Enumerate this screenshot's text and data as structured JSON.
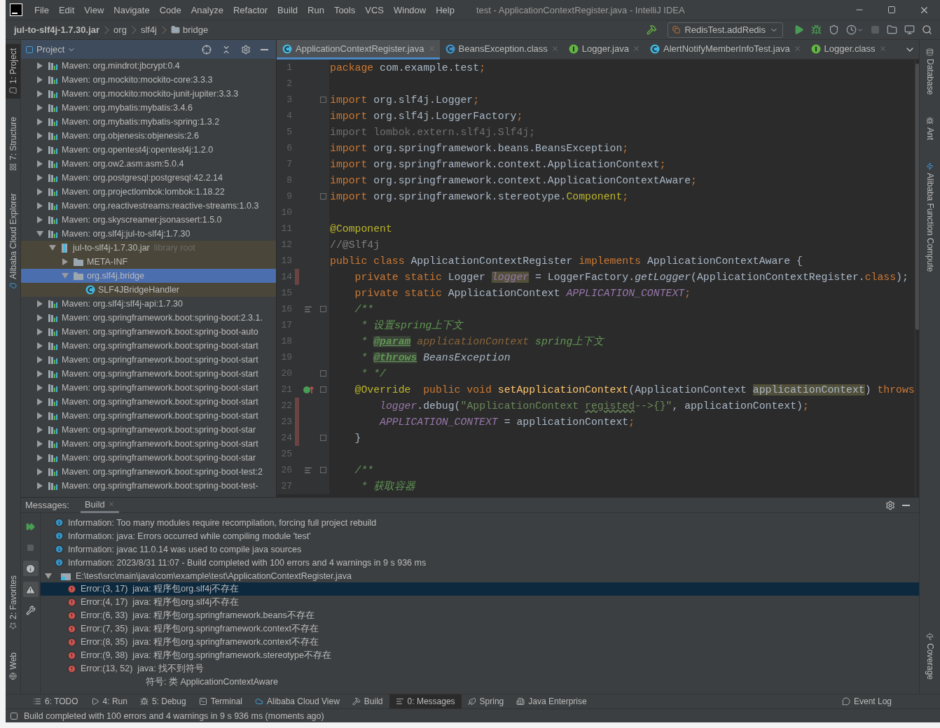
{
  "window": {
    "title": "test - ApplicationContextRegister.java - IntelliJ IDEA"
  },
  "menu": [
    "File",
    "Edit",
    "View",
    "Navigate",
    "Code",
    "Analyze",
    "Refactor",
    "Build",
    "Run",
    "Tools",
    "VCS",
    "Window",
    "Help"
  ],
  "breadcrumb": [
    {
      "label": "jul-to-slf4j-1.7.30.jar",
      "kind": "jar"
    },
    {
      "label": "org",
      "kind": "package"
    },
    {
      "label": "slf4j",
      "kind": "package"
    },
    {
      "label": "bridge",
      "kind": "folder"
    }
  ],
  "run_config": "RedisTest.addRedis",
  "left_stripe": {
    "top": [
      {
        "label": "1: Project",
        "kind": "project",
        "selected": true
      },
      {
        "label": "7: Structure",
        "kind": "structure",
        "selected": false
      },
      {
        "label": "Alibaba Cloud Explorer",
        "kind": "cloud",
        "selected": false
      }
    ],
    "bottom": [
      {
        "label": "2: Favorites",
        "kind": "favorites",
        "selected": false
      },
      {
        "label": "Web",
        "kind": "web",
        "selected": false
      }
    ]
  },
  "right_stripe": {
    "top": [
      {
        "label": "Database",
        "kind": "database"
      },
      {
        "label": "Ant",
        "kind": "ant"
      },
      {
        "label": "Alibaba Function Compute",
        "kind": "function"
      }
    ],
    "bottom": [
      {
        "label": "Coverage",
        "kind": "coverage"
      }
    ]
  },
  "project": {
    "title": "Project",
    "items": [
      {
        "kind": "library",
        "label": "Maven: org.mindrot:jbcrypt:0.4",
        "expanded": false,
        "selected": false
      },
      {
        "kind": "library",
        "label": "Maven: org.mockito:mockito-core:3.3.3",
        "expanded": false,
        "selected": false
      },
      {
        "kind": "library",
        "label": "Maven: org.mockito:mockito-junit-jupiter:3.3.3",
        "expanded": false,
        "selected": false
      },
      {
        "kind": "library",
        "label": "Maven: org.mybatis:mybatis:3.4.6",
        "expanded": false,
        "selected": false
      },
      {
        "kind": "library",
        "label": "Maven: org.mybatis:mybatis-spring:1.3.2",
        "expanded": false,
        "selected": false
      },
      {
        "kind": "library",
        "label": "Maven: org.objenesis:objenesis:2.6",
        "expanded": false,
        "selected": false
      },
      {
        "kind": "library",
        "label": "Maven: org.opentest4j:opentest4j:1.2.0",
        "expanded": false,
        "selected": false
      },
      {
        "kind": "library",
        "label": "Maven: org.ow2.asm:asm:5.0.4",
        "expanded": false,
        "selected": false
      },
      {
        "kind": "library",
        "label": "Maven: org.postgresql:postgresql:42.2.14",
        "expanded": false,
        "selected": false
      },
      {
        "kind": "library",
        "label": "Maven: org.projectlombok:lombok:1.18.22",
        "expanded": false,
        "selected": false
      },
      {
        "kind": "library",
        "label": "Maven: org.reactivestreams:reactive-streams:1.0.3",
        "expanded": false,
        "selected": false
      },
      {
        "kind": "library",
        "label": "Maven: org.skyscreamer:jsonassert:1.5.0",
        "expanded": false,
        "selected": false
      },
      {
        "kind": "library",
        "label": "Maven: org.slf4j:jul-to-slf4j:1.7.30",
        "expanded": true,
        "selected": false,
        "children": [
          {
            "kind": "jar",
            "label": "jul-to-slf4j-1.7.30.jar",
            "note": "library root",
            "expanded": true,
            "selected": false,
            "children": [
              {
                "kind": "folder",
                "label": "META-INF",
                "expanded": false,
                "selected": false
              },
              {
                "kind": "folder",
                "label": "org.slf4j.bridge",
                "expanded": true,
                "selected": true,
                "children": [
                  {
                    "kind": "class",
                    "label": "SLF4JBridgeHandler",
                    "selected": false
                  }
                ]
              }
            ]
          }
        ]
      },
      {
        "kind": "library",
        "label": "Maven: org.slf4j:slf4j-api:1.7.30",
        "expanded": false,
        "selected": false
      },
      {
        "kind": "library",
        "label": "Maven: org.springframework.boot:spring-boot:2.3.1.",
        "expanded": false,
        "selected": false
      },
      {
        "kind": "library",
        "label": "Maven: org.springframework.boot:spring-boot-auto",
        "expanded": false,
        "selected": false
      },
      {
        "kind": "library",
        "label": "Maven: org.springframework.boot:spring-boot-start",
        "expanded": false,
        "selected": false
      },
      {
        "kind": "library",
        "label": "Maven: org.springframework.boot:spring-boot-start",
        "expanded": false,
        "selected": false
      },
      {
        "kind": "library",
        "label": "Maven: org.springframework.boot:spring-boot-start",
        "expanded": false,
        "selected": false
      },
      {
        "kind": "library",
        "label": "Maven: org.springframework.boot:spring-boot-start",
        "expanded": false,
        "selected": false
      },
      {
        "kind": "library",
        "label": "Maven: org.springframework.boot:spring-boot-start",
        "expanded": false,
        "selected": false
      },
      {
        "kind": "library",
        "label": "Maven: org.springframework.boot:spring-boot-start",
        "expanded": false,
        "selected": false
      },
      {
        "kind": "library",
        "label": "Maven: org.springframework.boot:spring-boot-star",
        "expanded": false,
        "selected": false
      },
      {
        "kind": "library",
        "label": "Maven: org.springframework.boot:spring-boot-start",
        "expanded": false,
        "selected": false
      },
      {
        "kind": "library",
        "label": "Maven: org.springframework.boot:spring-boot-star",
        "expanded": false,
        "selected": false
      },
      {
        "kind": "library",
        "label": "Maven: org.springframework.boot:spring-boot-test:2",
        "expanded": false,
        "selected": false
      },
      {
        "kind": "library",
        "label": "Maven: org.springframework.boot:spring-boot-test-",
        "expanded": false,
        "selected": false
      }
    ]
  },
  "editor": {
    "tabs": [
      {
        "label": "ApplicationContextRegister.java",
        "kind": "class",
        "selected": true
      },
      {
        "label": "BeansException.class",
        "kind": "exception",
        "selected": false
      },
      {
        "label": "Logger.java",
        "kind": "interface",
        "selected": false
      },
      {
        "label": "AlertNotifyMemberInfoTest.java",
        "kind": "test",
        "selected": false
      },
      {
        "label": "Logger.class",
        "kind": "interface",
        "selected": false
      }
    ],
    "lines": [
      {
        "number": "1",
        "kind": "code",
        "fold": false,
        "changed": false,
        "tokens": [
          {
            "kind": "kw",
            "text": "package"
          },
          {
            "kind": "plain",
            "text": " com.example.test"
          },
          {
            "kind": "kw",
            "text": ";"
          }
        ]
      },
      {
        "number": "2",
        "kind": "code",
        "fold": false,
        "changed": false
      },
      {
        "number": "3",
        "kind": "code",
        "fold": true,
        "changed": false,
        "tokens": [
          {
            "kind": "kw",
            "text": "import"
          },
          {
            "kind": "plain",
            "text": " org.slf4j.Logger"
          },
          {
            "kind": "kw",
            "text": ";"
          }
        ]
      },
      {
        "number": "4",
        "kind": "code",
        "fold": false,
        "changed": false,
        "tokens": [
          {
            "kind": "kw",
            "text": "import"
          },
          {
            "kind": "plain",
            "text": " org.slf4j.LoggerFactory"
          },
          {
            "kind": "kw",
            "text": ";"
          }
        ]
      },
      {
        "number": "5",
        "kind": "code",
        "fold": false,
        "changed": false,
        "tokens": [
          {
            "kind": "unused",
            "text": "import lombok.extern.slf4j.Slf4j;"
          }
        ]
      },
      {
        "number": "6",
        "kind": "code",
        "fold": false,
        "changed": false,
        "tokens": [
          {
            "kind": "kw",
            "text": "import"
          },
          {
            "kind": "plain",
            "text": " org.springframework.beans.BeansException"
          },
          {
            "kind": "kw",
            "text": ";"
          }
        ]
      },
      {
        "number": "7",
        "kind": "code",
        "fold": false,
        "changed": false,
        "tokens": [
          {
            "kind": "kw",
            "text": "import"
          },
          {
            "kind": "plain",
            "text": " org.springframework.context.ApplicationContext"
          },
          {
            "kind": "kw",
            "text": ";"
          }
        ]
      },
      {
        "number": "8",
        "kind": "code",
        "fold": false,
        "changed": false,
        "tokens": [
          {
            "kind": "kw",
            "text": "import"
          },
          {
            "kind": "plain",
            "text": " org.springframework.context.ApplicationContextAware"
          },
          {
            "kind": "kw",
            "text": ";"
          }
        ]
      },
      {
        "number": "9",
        "kind": "code",
        "fold": true,
        "changed": false,
        "tokens": [
          {
            "kind": "kw",
            "text": "import"
          },
          {
            "kind": "plain",
            "text": " org.springframework.stereotype."
          },
          {
            "kind": "ann",
            "text": "Component"
          },
          {
            "kind": "kw",
            "text": ";"
          }
        ]
      },
      {
        "number": "10",
        "kind": "code",
        "fold": false,
        "changed": false
      },
      {
        "number": "11",
        "kind": "code",
        "fold": false,
        "changed": false,
        "tokens": [
          {
            "kind": "ann",
            "text": "@Component"
          }
        ]
      },
      {
        "number": "12",
        "kind": "code",
        "fold": false,
        "changed": false,
        "tokens": [
          {
            "kind": "comment",
            "text": "//@Slf4j"
          }
        ]
      },
      {
        "number": "13",
        "kind": "code",
        "fold": false,
        "changed": false,
        "tokens": [
          {
            "kind": "kw",
            "text": "public class"
          },
          {
            "kind": "plain",
            "text": " ApplicationContextRegister "
          },
          {
            "kind": "kw",
            "text": "implements"
          },
          {
            "kind": "plain",
            "text": " ApplicationContextAware {"
          }
        ]
      },
      {
        "number": "14",
        "kind": "code",
        "fold": false,
        "changed": true,
        "tokens": [
          {
            "kind": "kw",
            "text": "    private static"
          },
          {
            "kind": "plain",
            "text": " Logger "
          },
          {
            "kind": "field-hl",
            "text": "logger"
          },
          {
            "kind": "plain",
            "text": " = LoggerFactory."
          },
          {
            "kind": "call",
            "text": "getLogger"
          },
          {
            "kind": "plain",
            "text": "(ApplicationContextRegister."
          },
          {
            "kind": "kw",
            "text": "class"
          },
          {
            "kind": "plain",
            "text": ");"
          }
        ]
      },
      {
        "number": "15",
        "kind": "code",
        "fold": false,
        "changed": false,
        "tokens": [
          {
            "kind": "kw",
            "text": "    private static"
          },
          {
            "kind": "plain",
            "text": " ApplicationContext "
          },
          {
            "kind": "field",
            "text": "APPLICATION_CONTEXT"
          },
          {
            "kind": "kw",
            "text": ";"
          }
        ]
      },
      {
        "number": "16",
        "kind": "doc",
        "fold": true,
        "changed": false,
        "tokens": [
          {
            "kind": "doc",
            "text": "    /**"
          }
        ]
      },
      {
        "number": "17",
        "kind": "code",
        "fold": false,
        "changed": false,
        "tokens": [
          {
            "kind": "doc",
            "text": "     * 设置spring上下文"
          }
        ]
      },
      {
        "number": "18",
        "kind": "code",
        "fold": false,
        "changed": false,
        "tokens": [
          {
            "kind": "doc",
            "text": "     * "
          },
          {
            "kind": "doctag",
            "text": "@param"
          },
          {
            "kind": "docparam",
            "text": " applicationContext"
          },
          {
            "kind": "doc",
            "text": " spring上下文"
          }
        ]
      },
      {
        "number": "19",
        "kind": "code",
        "fold": false,
        "changed": false,
        "tokens": [
          {
            "kind": "doc",
            "text": "     * "
          },
          {
            "kind": "doctag",
            "text": "@throws"
          },
          {
            "kind": "docref",
            "text": " BeansException"
          }
        ]
      },
      {
        "number": "20",
        "kind": "code",
        "fold": true,
        "changed": false,
        "tokens": [
          {
            "kind": "doc",
            "text": "     * */"
          }
        ]
      },
      {
        "number": "21",
        "kind": "override",
        "fold": true,
        "changed": false,
        "tokens": [
          {
            "kind": "ann",
            "text": "    @Override"
          },
          {
            "kind": "kw",
            "text": "  public void "
          },
          {
            "kind": "decl",
            "text": "setApplicationContext"
          },
          {
            "kind": "plain",
            "text": "(ApplicationContext "
          },
          {
            "kind": "var-hl",
            "text": "applicationContext"
          },
          {
            "kind": "plain",
            "text": ") "
          },
          {
            "kind": "kw",
            "text": "throws"
          }
        ]
      },
      {
        "number": "22",
        "kind": "code",
        "fold": false,
        "changed": true,
        "tokens": [
          {
            "kind": "field",
            "text": "        logger"
          },
          {
            "kind": "plain",
            "text": ".debug("
          },
          {
            "kind": "str",
            "text": "\"ApplicationContext "
          },
          {
            "kind": "typo",
            "text": "registed"
          },
          {
            "kind": "str",
            "text": "-->{}\""
          },
          {
            "kind": "plain",
            "text": ", applicationContext)"
          },
          {
            "kind": "kw",
            "text": ";"
          }
        ]
      },
      {
        "number": "23",
        "kind": "code",
        "fold": false,
        "changed": true,
        "tokens": [
          {
            "kind": "field",
            "text": "        APPLICATION_CONTEXT"
          },
          {
            "kind": "plain",
            "text": " = applicationContext"
          },
          {
            "kind": "kw",
            "text": ";"
          }
        ]
      },
      {
        "number": "24",
        "kind": "code",
        "fold": true,
        "changed": true,
        "tokens": [
          {
            "kind": "plain",
            "text": "    }"
          }
        ]
      },
      {
        "number": "25",
        "kind": "code",
        "fold": false,
        "changed": false
      },
      {
        "number": "26",
        "kind": "doc",
        "fold": true,
        "changed": false,
        "tokens": [
          {
            "kind": "doc",
            "text": "    /**"
          }
        ]
      },
      {
        "number": "27",
        "kind": "code",
        "fold": false,
        "changed": false,
        "tokens": [
          {
            "kind": "doc",
            "text": "     * 获取容器"
          }
        ]
      }
    ]
  },
  "messages": {
    "label": "Messages:",
    "tabs": [
      {
        "label": "Build",
        "selected": true
      }
    ],
    "items": [
      {
        "kind": "info",
        "text": "Information: Too many modules require recompilation, forcing full project rebuild",
        "selected": false
      },
      {
        "kind": "info",
        "text": "Information: java: Errors occurred while compiling module 'test'",
        "selected": false
      },
      {
        "kind": "info",
        "text": "Information: javac 11.0.14 was used to compile java sources",
        "selected": false
      },
      {
        "kind": "info",
        "text": "Information: 2023/8/31 11:07 - Build completed with 100 errors and 4 warnings in 9 s 936 ms",
        "selected": false
      },
      {
        "kind": "file",
        "text": "E:\\test\\src\\main\\java\\com\\example\\test\\ApplicationContextRegister.java",
        "expanded": true,
        "selected": false
      },
      {
        "kind": "error",
        "text": "Error:(3, 17)  java: 程序包org.slf4j不存在",
        "selected": true
      },
      {
        "kind": "error",
        "text": "Error:(4, 17)  java: 程序包org.slf4j不存在",
        "selected": false
      },
      {
        "kind": "error",
        "text": "Error:(6, 33)  java: 程序包org.springframework.beans不存在",
        "selected": false
      },
      {
        "kind": "error",
        "text": "Error:(7, 35)  java: 程序包org.springframework.context不存在",
        "selected": false
      },
      {
        "kind": "error",
        "text": "Error:(8, 35)  java: 程序包org.springframework.context不存在",
        "selected": false
      },
      {
        "kind": "error",
        "text": "Error:(9, 38)  java: 程序包org.springframework.stereotype不存在",
        "selected": false
      },
      {
        "kind": "error",
        "text": "Error:(13, 52)  java: 找不到符号",
        "detail": "符号: 类 ApplicationContextAware",
        "selected": false
      }
    ]
  },
  "tool_windows": [
    {
      "label": "6: TODO",
      "kind": "todo",
      "selected": false
    },
    {
      "label": "4: Run",
      "kind": "run",
      "selected": false
    },
    {
      "label": "5: Debug",
      "kind": "debug",
      "selected": false
    },
    {
      "label": "Terminal",
      "kind": "terminal",
      "selected": false
    },
    {
      "label": "Alibaba Cloud View",
      "kind": "cloud",
      "selected": false
    },
    {
      "label": "Build",
      "kind": "build",
      "selected": false
    },
    {
      "label": "0: Messages",
      "kind": "messages",
      "selected": true
    },
    {
      "label": "Spring",
      "kind": "spring",
      "selected": false
    },
    {
      "label": "Java Enterprise",
      "kind": "enterprise",
      "selected": false
    }
  ],
  "event_log": "Event Log",
  "status_bar": "Build completed with 100 errors and 4 warnings in 9 s 936 ms (moments ago)"
}
